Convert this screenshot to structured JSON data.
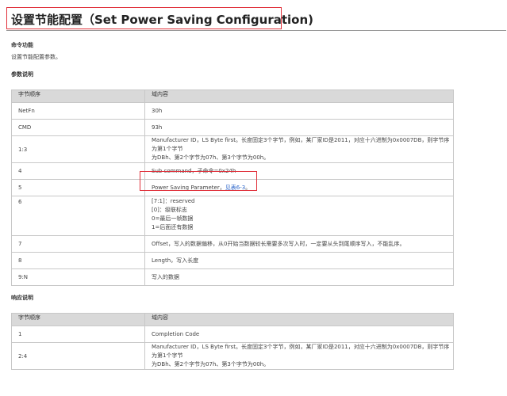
{
  "title": "设置节能配置（Set Power Saving Configuration)",
  "command_function": {
    "heading": "命令功能",
    "text": "设置节能配置参数。"
  },
  "params": {
    "heading": "参数说明",
    "columns": [
      "字节顺序",
      "域内容"
    ],
    "rows": [
      {
        "order": "NetFn",
        "lines": [
          "30h"
        ]
      },
      {
        "order": "CMD",
        "lines": [
          "93h"
        ]
      },
      {
        "order": "1:3",
        "lines": [
          "Manufacturer ID，LS Byte first。长度固定3个字节，例如，某厂家ID是2011，对应十六进制为0x0007DB，则字节序为第1个字节",
          "为DBh、第2个字节为07h、第3个字节为00h。"
        ]
      },
      {
        "order": "4",
        "lines": [
          "Sub command，子命令=0x24h"
        ]
      },
      {
        "order": "5",
        "lines": [
          "Power Saving Parameter，"
        ],
        "link": "见表6-3",
        "suffix": "。"
      },
      {
        "order": "6",
        "lines": [
          "[7:1]：reserved",
          "[0]：级联标志",
          "0=最后一帧数据",
          "1=后面还有数据"
        ]
      },
      {
        "order": "7",
        "lines": [
          "Offset，写入的数据偏移，从0开始当数据较长需要多次写入时，一定要从头到尾顺序写入，不能乱序。"
        ]
      },
      {
        "order": "8",
        "lines": [
          "Length，写入长度"
        ]
      },
      {
        "order": "9:N",
        "lines": [
          "写入的数据"
        ]
      }
    ]
  },
  "response": {
    "heading": "响应说明",
    "columns": [
      "字节顺序",
      "域内容"
    ],
    "rows": [
      {
        "order": "1",
        "lines": [
          "Completion Code"
        ]
      },
      {
        "order": "2:4",
        "lines": [
          "Manufacturer ID，LS Byte first。长度固定3个字节，例如，某厂家ID是2011，对应十六进制为0x0007DB，则字节序为第1个字节",
          "为DBh、第2个字节为07h、第3个字节为00h。"
        ]
      }
    ]
  },
  "colors": {
    "highlight_border": "#e0303a",
    "link": "#2b64c9",
    "header_bg": "#d9d9d9"
  }
}
